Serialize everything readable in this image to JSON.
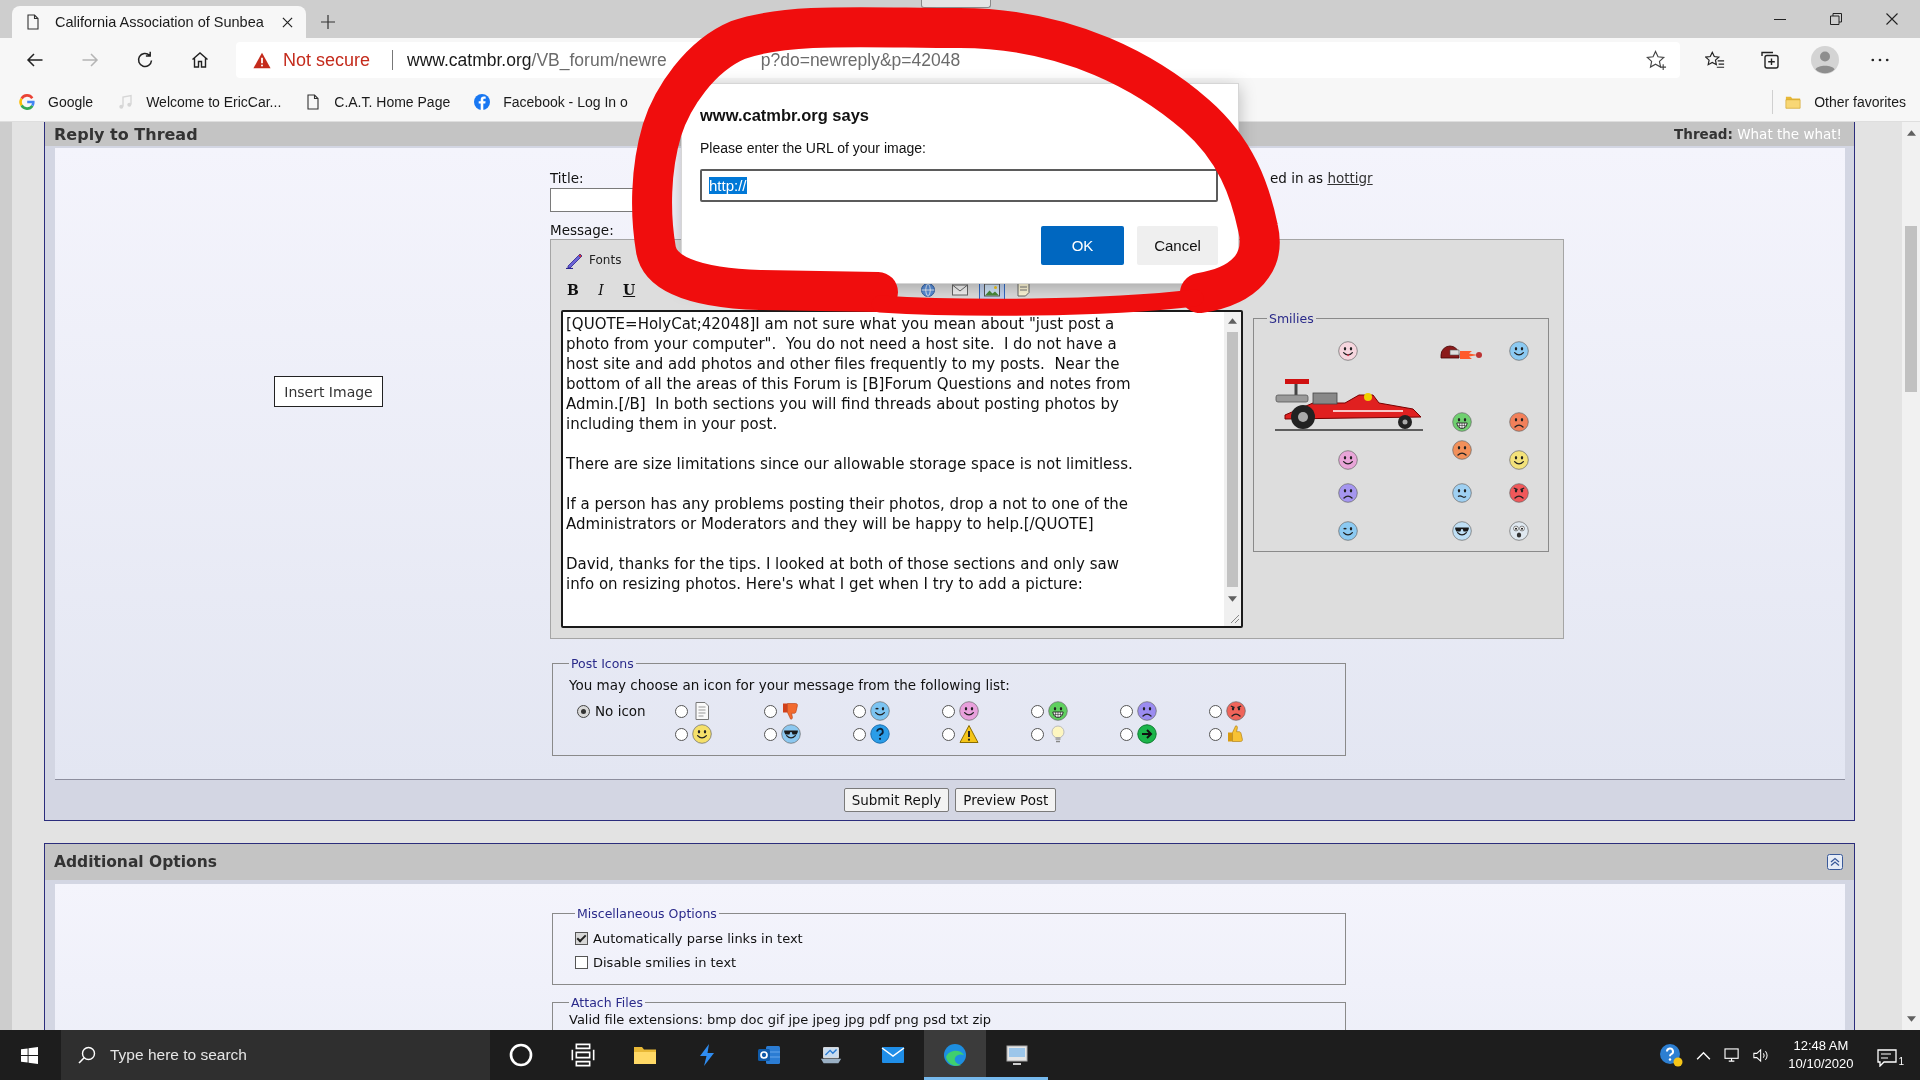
{
  "browser": {
    "tab": {
      "title": "California Association of Sunbea"
    },
    "address_bar": {
      "security_label": "Not secure",
      "url_host": "www.catmbr.org",
      "url_path": "/VB_forum/newre",
      "url_tail": "p?do=newreply&p=42048"
    },
    "bookmarks": [
      {
        "label": "Google"
      },
      {
        "label": "Welcome to EricCar..."
      },
      {
        "label": "C.A.T. Home Page"
      },
      {
        "label": "Facebook - Log In o"
      }
    ],
    "other_favorites": "Other favorites"
  },
  "reply_panel": {
    "title": "Reply to Thread",
    "thread_label": "Thread:",
    "thread_title": "What the what!",
    "insert_image_button": "Insert Image",
    "title_label": "Title:",
    "logged_in_text": "ed in as",
    "username_link": "hottigr",
    "message_label": "Message:",
    "editor": {
      "fonts_label": "Fonts",
      "format_buttons": [
        "B",
        "I",
        "U"
      ],
      "insert_buttons": [
        {
          "pressed": false
        },
        {
          "pressed": false
        },
        {
          "pressed": true
        },
        {
          "pressed": false
        }
      ],
      "message_paragraphs": [
        [
          "[QUOTE=HolyCat;42048]I am not sure what you mean about \"just post a",
          "photo from your computer\".  You do not need a host site.  I do not have a",
          "host site and add photos and other files frequently to my posts.  Near the",
          "bottom of all the areas of this Forum is [B]Forum Questions and notes from",
          "Admin.[/B]  In both sections you will find threads about posting photos by",
          "including them in your post."
        ],
        [
          "There are size limitations since our allowable storage space is not limitless."
        ],
        [
          "If a person has any problems posting their photos, drop a not to one of the",
          "Administrators or Moderators and they will be happy to help.[/QUOTE]"
        ],
        [
          "David, thanks for the tips. I looked at both of those sections and only saw",
          "info on resizing photos. Here's what I get when I try to add a picture:"
        ]
      ]
    },
    "smilies": {
      "legend": "Smilies"
    },
    "post_icons": {
      "legend": "Post Icons",
      "prompt": "You may choose an icon for your message from the following list:",
      "no_icon": {
        "label": "No icon",
        "selected": true
      },
      "icons": [
        {
          "selected": false
        },
        {
          "selected": false
        },
        {
          "selected": false
        },
        {
          "selected": false
        },
        {
          "selected": false
        },
        {
          "selected": false
        },
        {
          "selected": false
        },
        {
          "selected": false
        },
        {
          "selected": false
        },
        {
          "selected": false
        },
        {
          "selected": false
        },
        {
          "selected": false
        },
        {
          "selected": false
        },
        {
          "selected": false
        }
      ]
    },
    "buttons": [
      "Submit Reply",
      "Preview Post"
    ]
  },
  "additional_options": {
    "title": "Additional Options",
    "misc": {
      "legend": "Miscellaneous Options",
      "options": [
        {
          "label": "Automatically parse links in text",
          "checked": true
        },
        {
          "label": "Disable smilies in text",
          "checked": false
        }
      ]
    },
    "attach": {
      "legend": "Attach Files",
      "text": "Valid file extensions: bmp doc gif jpe jpeg jpg pdf png psd txt zip"
    }
  },
  "dialog": {
    "title": "www.catmbr.org says",
    "message": "Please enter the URL of your image:",
    "input": {
      "value": "http://",
      "text_selected": true
    },
    "buttons": [
      {
        "label": "OK",
        "kind": "primary"
      },
      {
        "label": "Cancel",
        "kind": "secondary"
      }
    ]
  },
  "taskbar": {
    "search_placeholder": "Type here to search",
    "pinned_apps": [
      {
        "running": false,
        "focused": false
      },
      {
        "running": false,
        "focused": false
      },
      {
        "running": false,
        "focused": false
      },
      {
        "running": false,
        "focused": false
      },
      {
        "running": false,
        "focused": false
      },
      {
        "running": true,
        "focused": true
      },
      {
        "running": true,
        "focused": false
      }
    ],
    "time": "12:48 AM",
    "date": "10/10/2020",
    "notification_count": "1"
  }
}
